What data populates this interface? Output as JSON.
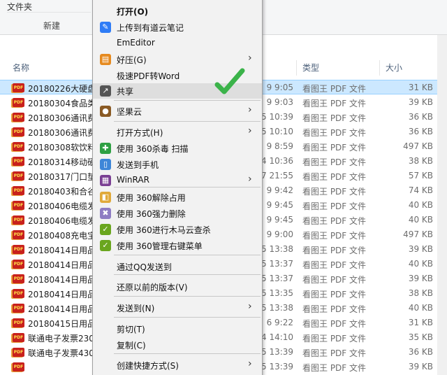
{
  "ribbon": {
    "folder_label": "文件夹",
    "new_label": "新建"
  },
  "columns": {
    "name": "名称",
    "type": "类型",
    "size": "大小"
  },
  "files": [
    {
      "name": "20180226大硬盘",
      "date": "9 9:05",
      "type": "看图王 PDF 文件",
      "size": "31 KB",
      "selected": true
    },
    {
      "name": "20180304食品类",
      "date": "9 9:03",
      "type": "看图王 PDF 文件",
      "size": "39 KB"
    },
    {
      "name": "20180306通讯费",
      "date": "5 10:39",
      "type": "看图王 PDF 文件",
      "size": "36 KB"
    },
    {
      "name": "20180306通讯费",
      "date": "5 10:10",
      "type": "看图王 PDF 文件",
      "size": "36 KB"
    },
    {
      "name": "20180308软饮料",
      "date": "9 8:59",
      "type": "看图王 PDF 文件",
      "size": "497 KB"
    },
    {
      "name": "20180314移动硬",
      "date": "4 10:36",
      "type": "看图王 PDF 文件",
      "size": "38 KB"
    },
    {
      "name": "20180317门口垫",
      "date": "7 21:55",
      "type": "看图王 PDF 文件",
      "size": "57 KB"
    },
    {
      "name": "20180403和合谷",
      "date": "9 9:42",
      "type": "看图王 PDF 文件",
      "size": "74 KB"
    },
    {
      "name": "20180406电缆发",
      "date": "9 9:45",
      "type": "看图王 PDF 文件",
      "size": "40 KB"
    },
    {
      "name": "20180406电缆发",
      "date": "9 9:45",
      "type": "看图王 PDF 文件",
      "size": "40 KB"
    },
    {
      "name": "20180408充电宝",
      "date": "9 9:00",
      "type": "看图王 PDF 文件",
      "size": "497 KB"
    },
    {
      "name": "20180414日用品",
      "date": "5 13:38",
      "type": "看图王 PDF 文件",
      "size": "39 KB"
    },
    {
      "name": "20180414日用品",
      "date": "5 13:37",
      "type": "看图王 PDF 文件",
      "size": "40 KB"
    },
    {
      "name": "20180414日用品",
      "date": "5 13:37",
      "type": "看图王 PDF 文件",
      "size": "39 KB"
    },
    {
      "name": "20180414日用品",
      "date": "5 13:35",
      "type": "看图王 PDF 文件",
      "size": "38 KB"
    },
    {
      "name": "20180414日用品",
      "date": "5 13:38",
      "type": "看图王 PDF 文件",
      "size": "40 KB"
    },
    {
      "name": "20180415日用品",
      "date": "6 9:22",
      "type": "看图王 PDF 文件",
      "size": "31 KB"
    },
    {
      "name": "联通电子发票230",
      "date": "4 14:10",
      "type": "看图王 PDF 文件",
      "size": "35 KB"
    },
    {
      "name": "联通电子发票430",
      "date": "5 13:39",
      "type": "看图王 PDF 文件",
      "size": "36 KB"
    },
    {
      "name": "",
      "date": "5 13:39",
      "type": "看图王 PDF 文件",
      "size": "39 KB"
    }
  ],
  "pdf_badge": "PDF",
  "menu": [
    {
      "label": "打开(O)",
      "icon": "",
      "bold": true
    },
    {
      "label": "上传到有道云笔记",
      "icon": "youdao-note-icon",
      "color": "#2f7cf6"
    },
    {
      "label": "EmEditor",
      "icon": ""
    },
    {
      "label": "好压(G)",
      "icon": "haozip-icon",
      "color": "#e68a1f",
      "submenu": true
    },
    {
      "label": "极速PDF转Word",
      "icon": ""
    },
    {
      "label": "共享",
      "icon": "share-icon",
      "color": "#555555",
      "hover": true
    },
    {
      "label": "坚果云",
      "icon": "jianguoyun-icon",
      "color": "#8a5a24",
      "submenu": true
    },
    {
      "label": "打开方式(H)",
      "icon": "",
      "submenu": true
    },
    {
      "label": "使用 360杀毒 扫描",
      "icon": "360-antivirus-icon",
      "color": "#2ea043"
    },
    {
      "label": "发送到手机",
      "icon": "send-phone-icon",
      "color": "#3d86d8"
    },
    {
      "label": "WinRAR",
      "icon": "winrar-icon",
      "color": "#7a3f93",
      "submenu": true
    },
    {
      "label": "使用 360解除占用",
      "icon": "360-unlock-icon",
      "color": "#e0a93a"
    },
    {
      "label": "使用 360强力删除",
      "icon": "360-delete-icon",
      "color": "#8e7cc3"
    },
    {
      "label": "使用 360进行木马云查杀",
      "icon": "360-trojan-icon",
      "color": "#6aa61e"
    },
    {
      "label": "使用 360管理右键菜单",
      "icon": "360-menu-icon",
      "color": "#6aa61e"
    },
    {
      "label": "通过QQ发送到",
      "icon": ""
    },
    {
      "label": "还原以前的版本(V)",
      "icon": ""
    },
    {
      "label": "发送到(N)",
      "icon": "",
      "submenu": true
    },
    {
      "label": "剪切(T)",
      "icon": ""
    },
    {
      "label": "复制(C)",
      "icon": ""
    },
    {
      "label": "创建快捷方式(S)",
      "icon": "",
      "submenu": true
    }
  ],
  "accent": "#cce8ff",
  "check_color": "#3bb34a"
}
